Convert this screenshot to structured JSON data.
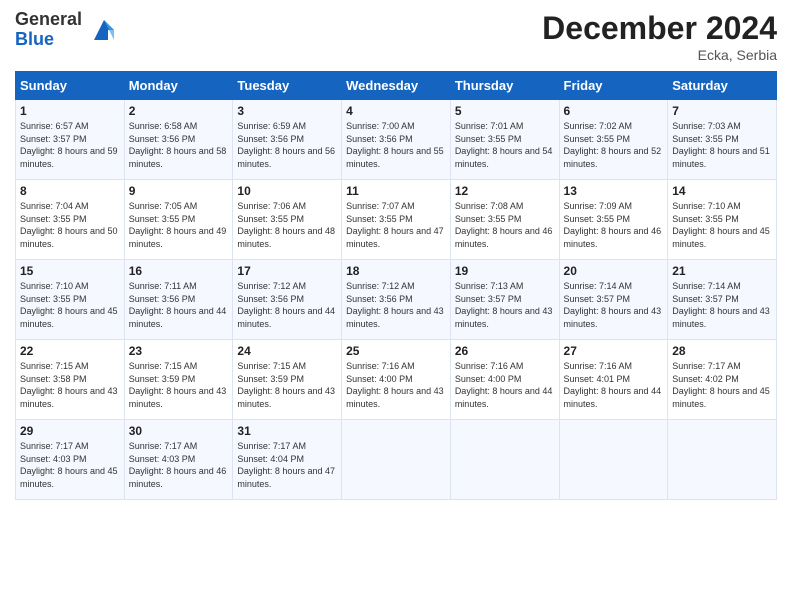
{
  "header": {
    "logo_line1": "General",
    "logo_line2": "Blue",
    "month": "December 2024",
    "location": "Ecka, Serbia"
  },
  "weekdays": [
    "Sunday",
    "Monday",
    "Tuesday",
    "Wednesday",
    "Thursday",
    "Friday",
    "Saturday"
  ],
  "weeks": [
    [
      {
        "day": "1",
        "rise": "6:57 AM",
        "set": "3:57 PM",
        "daylight": "8 hours and 59 minutes."
      },
      {
        "day": "2",
        "rise": "6:58 AM",
        "set": "3:56 PM",
        "daylight": "8 hours and 58 minutes."
      },
      {
        "day": "3",
        "rise": "6:59 AM",
        "set": "3:56 PM",
        "daylight": "8 hours and 56 minutes."
      },
      {
        "day": "4",
        "rise": "7:00 AM",
        "set": "3:56 PM",
        "daylight": "8 hours and 55 minutes."
      },
      {
        "day": "5",
        "rise": "7:01 AM",
        "set": "3:55 PM",
        "daylight": "8 hours and 54 minutes."
      },
      {
        "day": "6",
        "rise": "7:02 AM",
        "set": "3:55 PM",
        "daylight": "8 hours and 52 minutes."
      },
      {
        "day": "7",
        "rise": "7:03 AM",
        "set": "3:55 PM",
        "daylight": "8 hours and 51 minutes."
      }
    ],
    [
      {
        "day": "8",
        "rise": "7:04 AM",
        "set": "3:55 PM",
        "daylight": "8 hours and 50 minutes."
      },
      {
        "day": "9",
        "rise": "7:05 AM",
        "set": "3:55 PM",
        "daylight": "8 hours and 49 minutes."
      },
      {
        "day": "10",
        "rise": "7:06 AM",
        "set": "3:55 PM",
        "daylight": "8 hours and 48 minutes."
      },
      {
        "day": "11",
        "rise": "7:07 AM",
        "set": "3:55 PM",
        "daylight": "8 hours and 47 minutes."
      },
      {
        "day": "12",
        "rise": "7:08 AM",
        "set": "3:55 PM",
        "daylight": "8 hours and 46 minutes."
      },
      {
        "day": "13",
        "rise": "7:09 AM",
        "set": "3:55 PM",
        "daylight": "8 hours and 46 minutes."
      },
      {
        "day": "14",
        "rise": "7:10 AM",
        "set": "3:55 PM",
        "daylight": "8 hours and 45 minutes."
      }
    ],
    [
      {
        "day": "15",
        "rise": "7:10 AM",
        "set": "3:55 PM",
        "daylight": "8 hours and 45 minutes."
      },
      {
        "day": "16",
        "rise": "7:11 AM",
        "set": "3:56 PM",
        "daylight": "8 hours and 44 minutes."
      },
      {
        "day": "17",
        "rise": "7:12 AM",
        "set": "3:56 PM",
        "daylight": "8 hours and 44 minutes."
      },
      {
        "day": "18",
        "rise": "7:12 AM",
        "set": "3:56 PM",
        "daylight": "8 hours and 43 minutes."
      },
      {
        "day": "19",
        "rise": "7:13 AM",
        "set": "3:57 PM",
        "daylight": "8 hours and 43 minutes."
      },
      {
        "day": "20",
        "rise": "7:14 AM",
        "set": "3:57 PM",
        "daylight": "8 hours and 43 minutes."
      },
      {
        "day": "21",
        "rise": "7:14 AM",
        "set": "3:57 PM",
        "daylight": "8 hours and 43 minutes."
      }
    ],
    [
      {
        "day": "22",
        "rise": "7:15 AM",
        "set": "3:58 PM",
        "daylight": "8 hours and 43 minutes."
      },
      {
        "day": "23",
        "rise": "7:15 AM",
        "set": "3:59 PM",
        "daylight": "8 hours and 43 minutes."
      },
      {
        "day": "24",
        "rise": "7:15 AM",
        "set": "3:59 PM",
        "daylight": "8 hours and 43 minutes."
      },
      {
        "day": "25",
        "rise": "7:16 AM",
        "set": "4:00 PM",
        "daylight": "8 hours and 43 minutes."
      },
      {
        "day": "26",
        "rise": "7:16 AM",
        "set": "4:00 PM",
        "daylight": "8 hours and 44 minutes."
      },
      {
        "day": "27",
        "rise": "7:16 AM",
        "set": "4:01 PM",
        "daylight": "8 hours and 44 minutes."
      },
      {
        "day": "28",
        "rise": "7:17 AM",
        "set": "4:02 PM",
        "daylight": "8 hours and 45 minutes."
      }
    ],
    [
      {
        "day": "29",
        "rise": "7:17 AM",
        "set": "4:03 PM",
        "daylight": "8 hours and 45 minutes."
      },
      {
        "day": "30",
        "rise": "7:17 AM",
        "set": "4:03 PM",
        "daylight": "8 hours and 46 minutes."
      },
      {
        "day": "31",
        "rise": "7:17 AM",
        "set": "4:04 PM",
        "daylight": "8 hours and 47 minutes."
      },
      null,
      null,
      null,
      null
    ]
  ],
  "labels": {
    "sunrise": "Sunrise:",
    "sunset": "Sunset:",
    "daylight": "Daylight:"
  }
}
